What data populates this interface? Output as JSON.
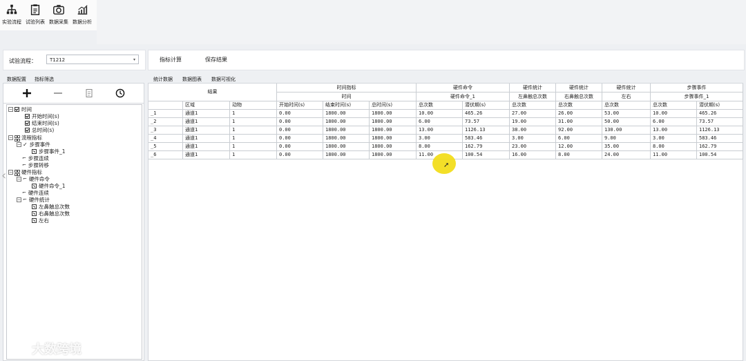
{
  "toolbar": {
    "items": [
      {
        "label": "实验流程",
        "icon": "flowchart-icon"
      },
      {
        "label": "试验列表",
        "icon": "clipboard-icon"
      },
      {
        "label": "数据采集",
        "icon": "camera-icon"
      },
      {
        "label": "数据分析",
        "icon": "analytics-icon"
      }
    ]
  },
  "left": {
    "flow_label": "试验流程：",
    "flow_value": "T1212",
    "tabs": [
      "数据配置",
      "指标筛选"
    ],
    "tools": [
      "add-icon",
      "remove-icon",
      "document-icon",
      "clock-icon"
    ],
    "tree": [
      {
        "label": "时间",
        "kind": "root-check"
      },
      {
        "label": "开始时间(s)",
        "kind": "check"
      },
      {
        "label": "结束时间(s)",
        "kind": "check"
      },
      {
        "label": "总时间(s)",
        "kind": "check"
      },
      {
        "label": "流程指标",
        "kind": "root-group"
      },
      {
        "label": "步骤事件",
        "kind": "tick"
      },
      {
        "label": "步骤事件_1",
        "kind": "leaf"
      },
      {
        "label": "步骤连续",
        "kind": "flag"
      },
      {
        "label": "步骤转移",
        "kind": "flag"
      },
      {
        "label": "硬件指标",
        "kind": "root-group"
      },
      {
        "label": "硬件命令",
        "kind": "flag-expand"
      },
      {
        "label": "硬件命令_1",
        "kind": "leaf"
      },
      {
        "label": "硬件连续",
        "kind": "flag"
      },
      {
        "label": "硬件统计",
        "kind": "flag-expand"
      },
      {
        "label": "左鼻触总次数",
        "kind": "leaf"
      },
      {
        "label": "右鼻触总次数",
        "kind": "leaf"
      },
      {
        "label": "左右",
        "kind": "leaf"
      }
    ]
  },
  "right": {
    "buttons": [
      "指标计算",
      "保存结果"
    ],
    "tabs": [
      "统计数据",
      "数据图表",
      "数据可视化"
    ],
    "table": {
      "group_row1": [
        "结果",
        "时间指标",
        "硬件命令",
        "硬件统计",
        "硬件统计",
        "硬件统计",
        "步骤事件"
      ],
      "group_row2": [
        "时间",
        "硬件命令_1",
        "左鼻触总次数",
        "右鼻触总次数",
        "左右",
        "步骤事件_1"
      ],
      "columns": [
        "",
        "区域",
        "动物",
        "开始时间(s)",
        "结束时间(s)",
        "总时间(s)",
        "总次数",
        "潜伏期(s)",
        "总次数",
        "总次数",
        "总次数",
        "总次数",
        "潜伏期(s)"
      ],
      "rows": [
        [
          "_1",
          "通道1",
          "1",
          "0.00",
          "1800.00",
          "1800.00",
          "10.00",
          "465.26",
          "27.00",
          "26.00",
          "53.00",
          "10.00",
          "465.26"
        ],
        [
          "_2",
          "通道1",
          "1",
          "0.00",
          "1800.00",
          "1800.00",
          "6.00",
          "73.57",
          "19.00",
          "31.00",
          "50.00",
          "6.00",
          "73.57"
        ],
        [
          "_3",
          "通道1",
          "1",
          "0.00",
          "1800.00",
          "1800.00",
          "13.00",
          "1126.13",
          "38.00",
          "92.00",
          "130.00",
          "13.00",
          "1126.13"
        ],
        [
          "_4",
          "通道1",
          "1",
          "0.00",
          "1800.00",
          "1800.00",
          "3.00",
          "583.46",
          "3.00",
          "6.00",
          "9.00",
          "3.00",
          "583.46"
        ],
        [
          "_5",
          "通道1",
          "1",
          "0.00",
          "1800.00",
          "1800.00",
          "8.00",
          "162.79",
          "23.00",
          "12.00",
          "35.00",
          "8.00",
          "162.79"
        ],
        [
          "_6",
          "通道1",
          "1",
          "0.00",
          "1800.00",
          "1800.00",
          "11.00",
          "100.54",
          "16.00",
          "8.00",
          "24.00",
          "11.00",
          "100.54"
        ]
      ]
    }
  },
  "watermark": "大数跨境"
}
